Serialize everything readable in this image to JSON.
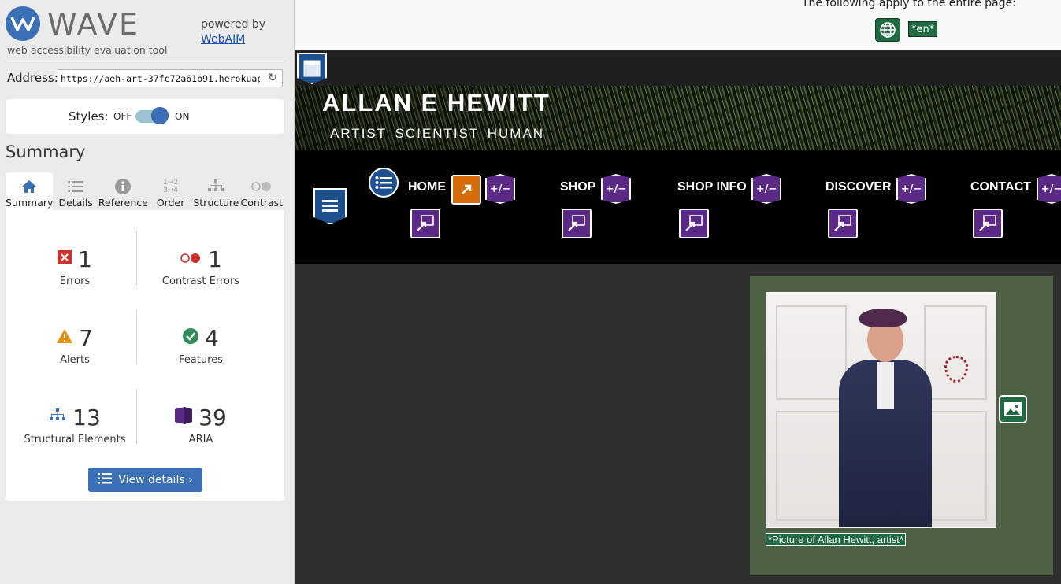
{
  "wave": {
    "logo_text": "WAVE",
    "logo_sub": "web accessibility evaluation tool",
    "powered_by": "powered by",
    "webaim_link": "WebAIM",
    "address_label": "Address:",
    "address_value": "https://aeh-art-37fc72a61b91.herokuapp.com/",
    "styles_label": "Styles:",
    "styles_off": "OFF",
    "styles_on": "ON",
    "summary_heading": "Summary",
    "tabs": [
      {
        "label": "Summary",
        "icon": "home-icon"
      },
      {
        "label": "Details",
        "icon": "list-icon"
      },
      {
        "label": "Reference",
        "icon": "info-icon"
      },
      {
        "label": "Order",
        "icon": "order-icon"
      },
      {
        "label": "Structure",
        "icon": "structure-icon"
      },
      {
        "label": "Contrast",
        "icon": "contrast-icon"
      }
    ],
    "stats": {
      "errors": {
        "count": "1",
        "label": "Errors"
      },
      "contrast_errors": {
        "count": "1",
        "label": "Contrast Errors"
      },
      "alerts": {
        "count": "7",
        "label": "Alerts"
      },
      "features": {
        "count": "4",
        "label": "Features"
      },
      "structural": {
        "count": "13",
        "label": "Structural Elements"
      },
      "aria": {
        "count": "39",
        "label": "ARIA"
      }
    },
    "view_details": "View details ›",
    "colors": {
      "accent": "#3b6fb6",
      "error": "#d0312d",
      "alert": "#e8900c",
      "feature": "#2e8b57",
      "aria": "#5b2a86"
    }
  },
  "site": {
    "page_notice": "The following apply to the entire page:",
    "lang_badge": "*en*",
    "title": "ALLAN E HEWITT",
    "tagline": "ARTIST SCIENTIST HUMAN",
    "nav": [
      "HOME",
      "SHOP",
      "SHOP INFO",
      "DISCOVER",
      "CONTACT"
    ],
    "aria_toggle": "+/−",
    "caption": "*Picture of Allan Hewitt, artist*"
  }
}
